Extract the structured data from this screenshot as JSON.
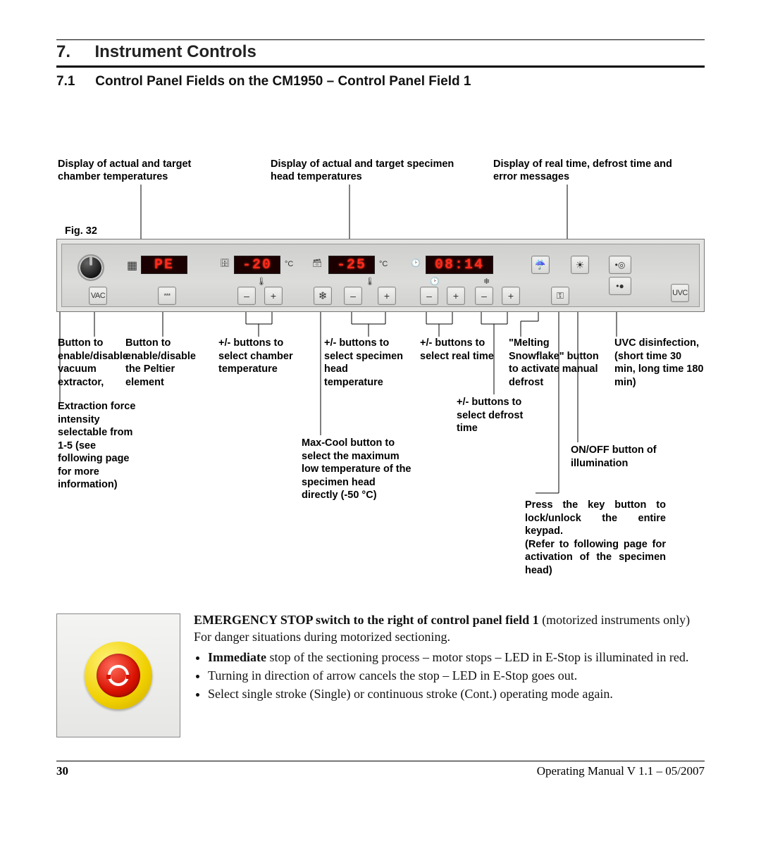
{
  "section": {
    "num": "7.",
    "title": "Instrument Controls"
  },
  "subsection": {
    "num": "7.1",
    "title": "Control Panel Fields on the CM1950 – Control Panel Field 1"
  },
  "figure_label": "Fig. 32",
  "callouts_top": {
    "chamber_temp": "Display of actual and target chamber temperatures",
    "specimen_temp": "Display of actual and target specimen head temperatures",
    "realtime": "Display of real time, defrost time and error messages"
  },
  "panel": {
    "chamber_display": "PE",
    "specimen_display": "-20",
    "head_display": "-25",
    "time_display": "08:14",
    "deg_c": "°C",
    "vac_label": "VAC",
    "uvc_label": "UVC",
    "peltier_label": "***",
    "minus": "–",
    "plus": "+"
  },
  "callouts_below": {
    "vac": "Button to enable/disable vacuum extractor,",
    "vac_extra": "Extraction force intensity selectable from 1-5 (see following page for more information)",
    "peltier": "Button to enable/disable the Peltier element",
    "chamber_pm": "+/- buttons to select chamber temperature",
    "specimen_pm": "+/- buttons to select specimen head temperature",
    "maxcool": "Max-Cool button to select the maximum low temperature of the specimen head directly (-50 °C)",
    "realtime_pm": "+/- buttons to select real time",
    "defrost_pm": "+/- buttons to select defrost time",
    "melting": "\"Melting Snowflake\" button to activate manual defrost",
    "onoff": "ON/OFF button of illumination",
    "key": "Press the key button to lock/unlock the entire keypad.\n(Refer to following page for activation of the specimen head)",
    "uvc": "UVC disinfection, (short time 30 min, long time 180 min)"
  },
  "estop": {
    "title_bold": "EMERGENCY STOP switch to the right of control panel field 1",
    "title_rest": " (motorized instruments only)",
    "line2": "For danger situations during motorized sectioning.",
    "bullet1_bold": "Immediate",
    "bullet1_rest": " stop of the sectioning process – motor stops – LED in E-Stop is illuminated in red.",
    "bullet2": "Turning in direction of arrow cancels the stop – LED in E-Stop goes out.",
    "bullet3": "Select single stroke (Single) or continuous stroke (Cont.) operating mode again."
  },
  "footer": {
    "page": "30",
    "right": "Operating Manual V 1.1 – 05/2007"
  }
}
